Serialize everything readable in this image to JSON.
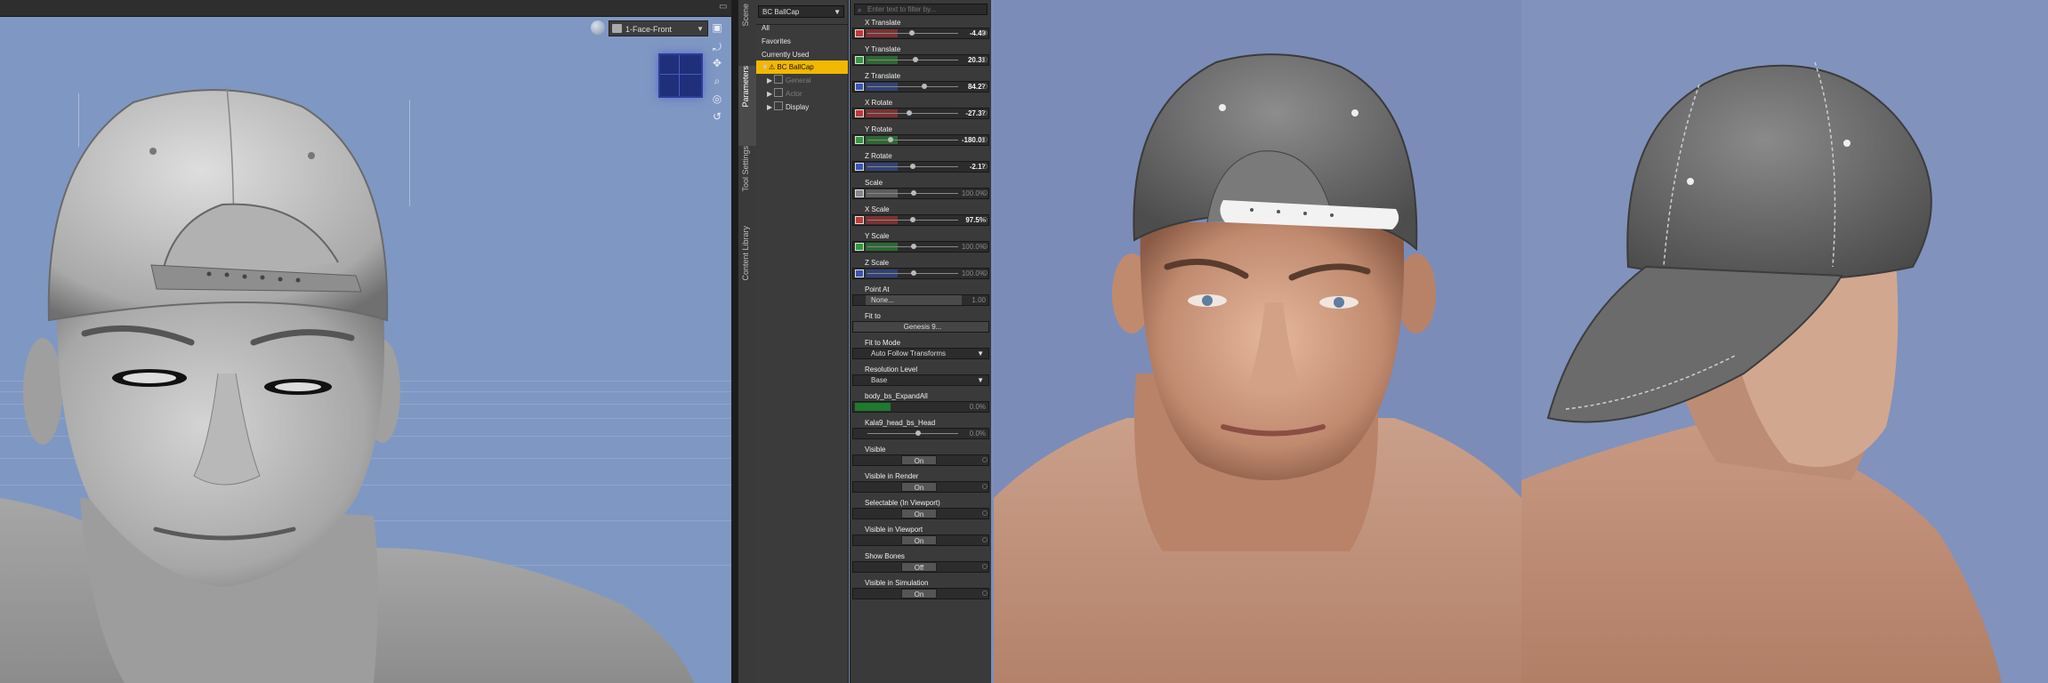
{
  "viewport": {
    "camera_label": "1-Face-Front",
    "tool_icons": [
      "pan-icon",
      "orbit-icon",
      "zoom-icon",
      "frame-icon",
      "reset-icon"
    ]
  },
  "tabs": [
    {
      "label": "Scene",
      "active": false
    },
    {
      "label": "Parameters",
      "active": true
    },
    {
      "label": "Tool Settings",
      "active": false
    },
    {
      "label": "Content Library",
      "active": false
    }
  ],
  "scene_tree": {
    "node_select": "BC BallCap",
    "items": [
      {
        "label": "All",
        "selected": false,
        "dim": false
      },
      {
        "label": "Favorites",
        "selected": false,
        "dim": false
      },
      {
        "label": "Currently Used",
        "selected": false,
        "dim": false
      },
      {
        "label": "BC BallCap",
        "selected": true,
        "dim": false
      },
      {
        "label": "General",
        "selected": false,
        "dim": true
      },
      {
        "label": "Actor",
        "selected": false,
        "dim": true
      },
      {
        "label": "Display",
        "selected": false,
        "dim": false
      }
    ]
  },
  "parameters": {
    "search_placeholder": "Enter text to filter by...",
    "items": [
      {
        "label": "X Translate",
        "value": "-4.49",
        "color": "#c0393b",
        "fraction": 0.48
      },
      {
        "label": "Y Translate",
        "value": "20.31",
        "color": "#2f9a3c",
        "fraction": 0.52
      },
      {
        "label": "Z Translate",
        "value": "84.27",
        "color": "#3a55b5",
        "fraction": 0.62
      },
      {
        "label": "X Rotate",
        "value": "-27.37",
        "color": "#c0393b",
        "fraction": 0.45
      },
      {
        "label": "Y Rotate",
        "value": "-180.01",
        "color": "#2f9a3c",
        "fraction": 0.25
      },
      {
        "label": "Z Rotate",
        "value": "-2.17",
        "color": "#3a55b5",
        "fraction": 0.49
      },
      {
        "label": "Scale",
        "value": "100.0%",
        "color": "#888888",
        "fraction": 0.5
      },
      {
        "label": "X Scale",
        "value": "97.5%",
        "color": "#c0393b",
        "fraction": 0.49
      },
      {
        "label": "Y Scale",
        "value": "100.0%",
        "color": "#2f9a3c",
        "fraction": 0.5
      },
      {
        "label": "Z Scale",
        "value": "100.0%",
        "color": "#3a55b5",
        "fraction": 0.5
      }
    ],
    "point_at": {
      "label": "Point At",
      "value": "None...",
      "extra": "1.00"
    },
    "fit_to": {
      "label": "Fit to",
      "value": "Genesis 9..."
    },
    "fit_to_mode": {
      "label": "Fit to Mode",
      "value": "Auto Follow Transforms"
    },
    "resolution_level": {
      "label": "Resolution Level",
      "value": "Base"
    },
    "morphs": [
      {
        "label": "body_bs_ExpandAll",
        "value": "0.0%",
        "color": "#1d7a2e"
      },
      {
        "label": "Kala9_head_bs_Head",
        "value": "0.0%",
        "color": "#555555"
      }
    ],
    "toggles": [
      {
        "label": "Visible",
        "value": "On"
      },
      {
        "label": "Visible in Render",
        "value": "On"
      },
      {
        "label": "Selectable (In Viewport)",
        "value": "On"
      },
      {
        "label": "Visible in Viewport",
        "value": "On"
      },
      {
        "label": "Show Bones",
        "value": "Off"
      },
      {
        "label": "Visible in Simulation",
        "value": "On"
      }
    ]
  }
}
